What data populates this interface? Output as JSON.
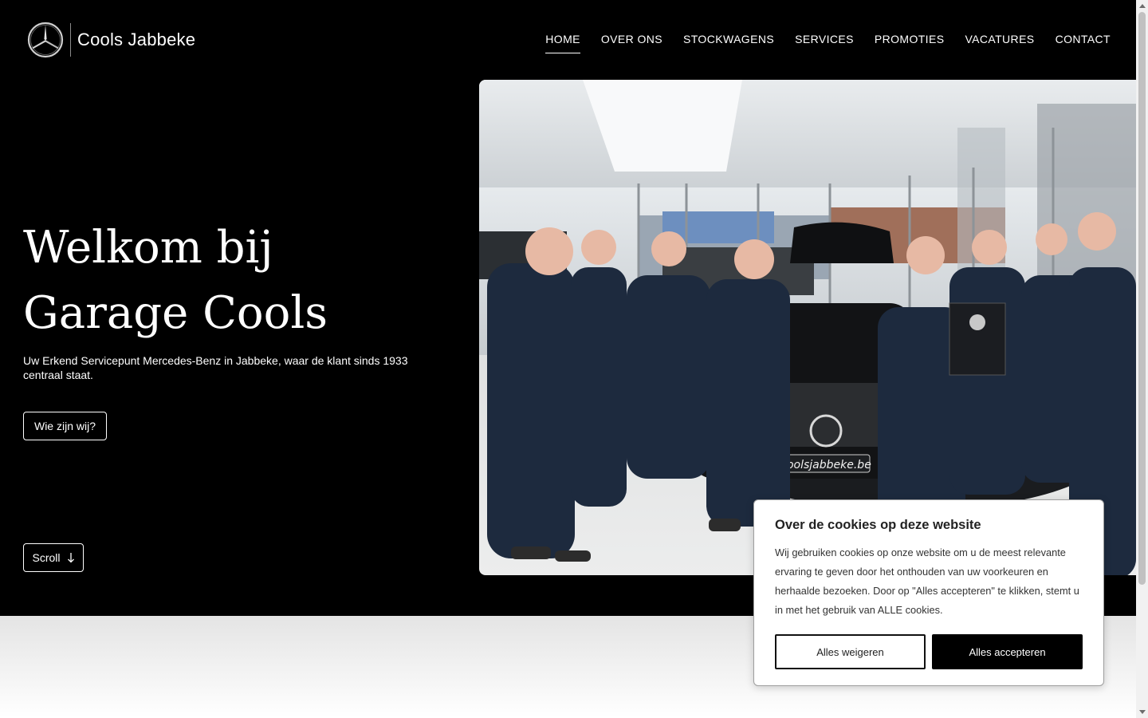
{
  "brand": {
    "name": "Cools Jabbeke",
    "logo_icon": "mercedes-star-icon"
  },
  "nav": {
    "items": [
      {
        "label": "HOME",
        "active": true
      },
      {
        "label": "OVER ONS",
        "active": false
      },
      {
        "label": "STOCKWAGENS",
        "active": false
      },
      {
        "label": "SERVICES",
        "active": false
      },
      {
        "label": "PROMOTIES",
        "active": false
      },
      {
        "label": "VACATURES",
        "active": false
      },
      {
        "label": "CONTACT",
        "active": false
      }
    ]
  },
  "hero": {
    "title": "Welkom bij Garage Cools",
    "subtitle": "Uw Erkend Servicepunt Mercedes-Benz in Jabbeke, waar de klant sinds 1933 centraal staat.",
    "cta_label": "Wie zijn wij?",
    "scroll_label": "Scroll",
    "scroll_icon": "arrow-down-icon",
    "photo_plate": "Coolsjabbeke.be"
  },
  "cookie": {
    "title": "Over de cookies op deze website",
    "text": "Wij gebruiken cookies op onze website om u de meest relevante ervaring te geven door het onthouden van uw voorkeuren en herhaalde bezoeken. Door op \"Alles accepteren\" te klikken, stemt u in met het gebruik van ALLE cookies.",
    "reject_label": "Alles weigeren",
    "accept_label": "Alles accepteren"
  },
  "colors": {
    "hero_bg": "#000000",
    "accent": "#ffffff"
  }
}
